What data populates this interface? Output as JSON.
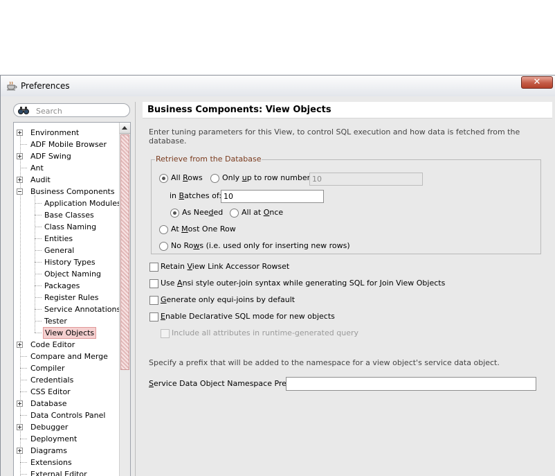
{
  "window": {
    "title": "Preferences",
    "close_glyph": "✕",
    "close_icon": "close-icon",
    "title_icon": "coffee-cup-icon"
  },
  "search": {
    "placeholder": "Search",
    "icon": "binoculars-icon"
  },
  "tree": {
    "items": [
      {
        "label": "Environment",
        "expandable": true,
        "expanded": false,
        "level": 0
      },
      {
        "label": "ADF Mobile Browser",
        "expandable": false,
        "level": 0
      },
      {
        "label": "ADF Swing",
        "expandable": true,
        "expanded": false,
        "level": 0
      },
      {
        "label": "Ant",
        "expandable": false,
        "level": 0
      },
      {
        "label": "Audit",
        "expandable": true,
        "expanded": false,
        "level": 0
      },
      {
        "label": "Business Components",
        "expandable": true,
        "expanded": true,
        "level": 0
      },
      {
        "label": "Application Modules",
        "level": 1
      },
      {
        "label": "Base Classes",
        "level": 1
      },
      {
        "label": "Class Naming",
        "level": 1
      },
      {
        "label": "Entities",
        "level": 1
      },
      {
        "label": "General",
        "level": 1
      },
      {
        "label": "History Types",
        "level": 1
      },
      {
        "label": "Object Naming",
        "level": 1
      },
      {
        "label": "Packages",
        "level": 1
      },
      {
        "label": "Register Rules",
        "level": 1
      },
      {
        "label": "Service Annotations",
        "level": 1
      },
      {
        "label": "Tester",
        "level": 1
      },
      {
        "label": "View Objects",
        "level": 1,
        "selected": true
      },
      {
        "label": "Code Editor",
        "expandable": true,
        "expanded": false,
        "level": 0
      },
      {
        "label": "Compare and Merge",
        "expandable": false,
        "level": 0
      },
      {
        "label": "Compiler",
        "expandable": false,
        "level": 0
      },
      {
        "label": "Credentials",
        "expandable": false,
        "level": 0
      },
      {
        "label": "CSS Editor",
        "expandable": false,
        "level": 0
      },
      {
        "label": "Database",
        "expandable": true,
        "expanded": false,
        "level": 0
      },
      {
        "label": "Data Controls Panel",
        "expandable": false,
        "level": 0
      },
      {
        "label": "Debugger",
        "expandable": true,
        "expanded": false,
        "level": 0
      },
      {
        "label": "Deployment",
        "expandable": false,
        "level": 0
      },
      {
        "label": "Diagrams",
        "expandable": true,
        "expanded": false,
        "level": 0
      },
      {
        "label": "Extensions",
        "expandable": false,
        "level": 0
      },
      {
        "label": "External Editor",
        "expandable": false,
        "level": 0
      }
    ]
  },
  "panel": {
    "title": "Business Components: View Objects",
    "description": "Enter tuning parameters for this View, to control SQL execution and how data is fetched from the database.",
    "retrieve": {
      "legend": "Retrieve from the Database",
      "all_rows_pre": "All ",
      "all_rows_key": "R",
      "all_rows_post": "ows",
      "only_up_pre": "Only ",
      "only_up_key": "u",
      "only_up_post": "p to row number",
      "only_up_value": "10",
      "batches_pre": "in ",
      "batches_key": "B",
      "batches_post": "atches of:",
      "batches_value": "10",
      "as_needed_pre": "As Nee",
      "as_needed_key": "d",
      "as_needed_post": "ed",
      "all_once_pre": "All at ",
      "all_once_key": "O",
      "all_once_post": "nce",
      "at_most_pre": "At ",
      "at_most_key": "M",
      "at_most_post": "ost One Row",
      "no_rows_pre": "No Ro",
      "no_rows_key": "w",
      "no_rows_post": "s (i.e. used only for inserting new rows)",
      "selected": "All Rows",
      "fetch_mode": "As Needed"
    },
    "options": [
      {
        "pre": "Retain ",
        "key": "V",
        "post": "iew Link Accessor Rowset",
        "checked": false
      },
      {
        "pre": "Use ",
        "key": "A",
        "post": "nsi style outer-join syntax while generating SQL for Join View Objects",
        "checked": false
      },
      {
        "pre": "",
        "key": "G",
        "post": "enerate only equi-joins by default",
        "checked": false
      },
      {
        "pre": "",
        "key": "E",
        "post": "nable Declarative SQL mode for new objects",
        "checked": false
      }
    ],
    "include_all": {
      "pre": "Include all attributes in runtime-",
      "key": "g",
      "post": "enerated query",
      "checked": false,
      "enabled": false
    },
    "prefix_description": "Specify a prefix that will be added to the namespace for a view object's service data object.",
    "prefix_label_key": "S",
    "prefix_label_post": "ervice Data Object Namespace Prefix:",
    "prefix_value": ""
  }
}
